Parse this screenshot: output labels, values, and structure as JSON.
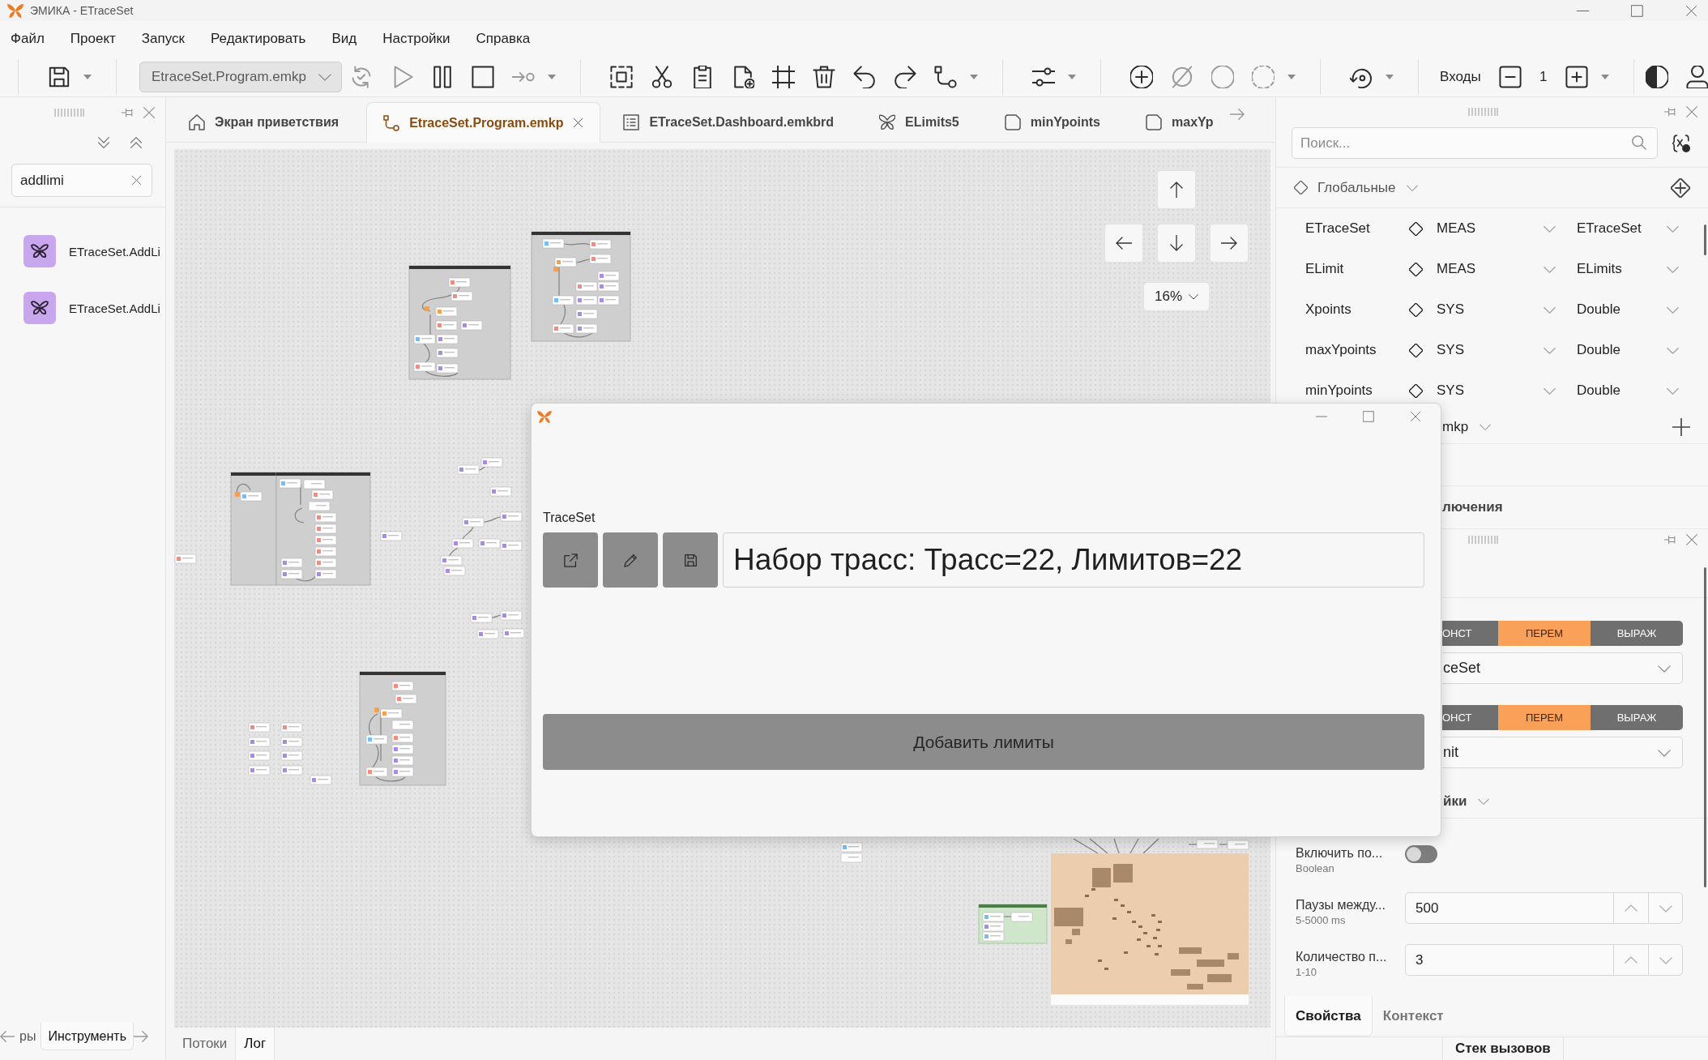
{
  "window": {
    "title": "ЭМИКА - ETraceSet"
  },
  "menu": [
    {
      "label": "Файл"
    },
    {
      "label": "Проект"
    },
    {
      "label": "Запуск"
    },
    {
      "label": "Редактировать"
    },
    {
      "label": "Вид"
    },
    {
      "label": "Настройки"
    },
    {
      "label": "Справка"
    }
  ],
  "toolbar": {
    "program": "EtraceSet.Program.emkp",
    "inputs_label": "Входы",
    "inputs_count": "1"
  },
  "left_panel": {
    "search": {
      "value": "addlimi"
    },
    "results": [
      {
        "label": "ETraceSet.AddLi"
      },
      {
        "label": "ETraceSet.AddLi"
      }
    ],
    "tabs": [
      {
        "label": "ры",
        "selected": false
      },
      {
        "label": "Инструменть",
        "selected": true
      }
    ]
  },
  "editor_tabs": [
    {
      "kind": "home",
      "label": "Экран приветствия",
      "selected": false
    },
    {
      "kind": "program",
      "label": "EtraceSet.Program.emkp",
      "selected": true
    },
    {
      "kind": "dashboard",
      "label": "ETraceSet.Dashboard.emkbrd",
      "selected": false
    },
    {
      "kind": "limits",
      "label": "ELimits5",
      "selected": false
    },
    {
      "kind": "variable",
      "label": "minYpoints",
      "selected": false
    },
    {
      "kind": "variable",
      "label": "maxYp",
      "selected": false
    }
  ],
  "canvas": {
    "zoom": "16%"
  },
  "dialog": {
    "field_label": "TraceSet",
    "value": "Набор трасс: Трасс=22, Лимитов=22",
    "button": "Добавить лимиты"
  },
  "variables_panel": {
    "search": {
      "placeholder": "Поиск..."
    },
    "group": "Глобальные",
    "variables": [
      {
        "name": "ETraceSet",
        "scope": "MEAS",
        "type": "ETraceSet"
      },
      {
        "name": "ELimit",
        "scope": "MEAS",
        "type": "ELimits"
      },
      {
        "name": "Xpoints",
        "scope": "SYS",
        "type": "Double"
      },
      {
        "name": "maxYpoints",
        "scope": "SYS",
        "type": "Double"
      },
      {
        "name": "minYpoints",
        "scope": "SYS",
        "type": "Double"
      }
    ],
    "group_2": "mkp",
    "section": "лючения"
  },
  "properties_panel": {
    "inputs": [
      {
        "modes": [
          {
            "label": "ОНСТ",
            "selected": false
          },
          {
            "label": "ПЕРЕМ",
            "selected": true
          },
          {
            "label": "ВЫРАЖ",
            "selected": false
          }
        ],
        "value": "ceSet"
      },
      {
        "modes": [
          {
            "label": "ОНСТ",
            "selected": false
          },
          {
            "label": "ПЕРЕМ",
            "selected": true
          },
          {
            "label": "ВЫРАЖ",
            "selected": false
          }
        ],
        "value": "nit"
      }
    ],
    "section": "йки",
    "settings": [
      {
        "kind": "toggle",
        "name": "Включить по...",
        "hint": "Boolean",
        "on": false
      },
      {
        "kind": "number",
        "name": "Паузы между...",
        "hint": "5-5000 ms",
        "value": "500"
      },
      {
        "kind": "number",
        "name": "Количество п...",
        "hint": "1-10",
        "value": "3"
      }
    ],
    "tabs": [
      {
        "label": "Свойства",
        "selected": true
      },
      {
        "label": "Контекст",
        "selected": false
      }
    ]
  },
  "bottom_tabs": [
    {
      "label": "Потоки",
      "selected": false
    },
    {
      "label": "Лог",
      "selected": true
    }
  ],
  "call_stack_tab": "Стек вызовов"
}
